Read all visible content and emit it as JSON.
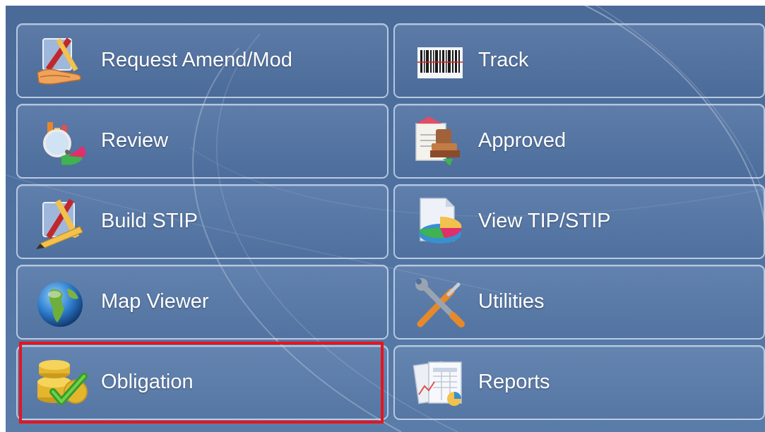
{
  "menu": {
    "tiles": [
      {
        "label": "Request Amend/Mod",
        "icon": "pencil-hand-icon"
      },
      {
        "label": "Track",
        "icon": "barcode-icon"
      },
      {
        "label": "Review",
        "icon": "magnifier-chart-icon"
      },
      {
        "label": "Approved",
        "icon": "stamp-icon"
      },
      {
        "label": "Build STIP",
        "icon": "drafting-tools-icon"
      },
      {
        "label": "View TIP/STIP",
        "icon": "pie-chart-document-icon"
      },
      {
        "label": "Map Viewer",
        "icon": "globe-icon"
      },
      {
        "label": "Utilities",
        "icon": "wrench-screwdriver-icon"
      },
      {
        "label": "Obligation",
        "icon": "coins-checkmark-icon"
      },
      {
        "label": "Reports",
        "icon": "report-document-icon"
      }
    ]
  },
  "highlight": {
    "target": "Obligation",
    "color": "#e8141c"
  }
}
